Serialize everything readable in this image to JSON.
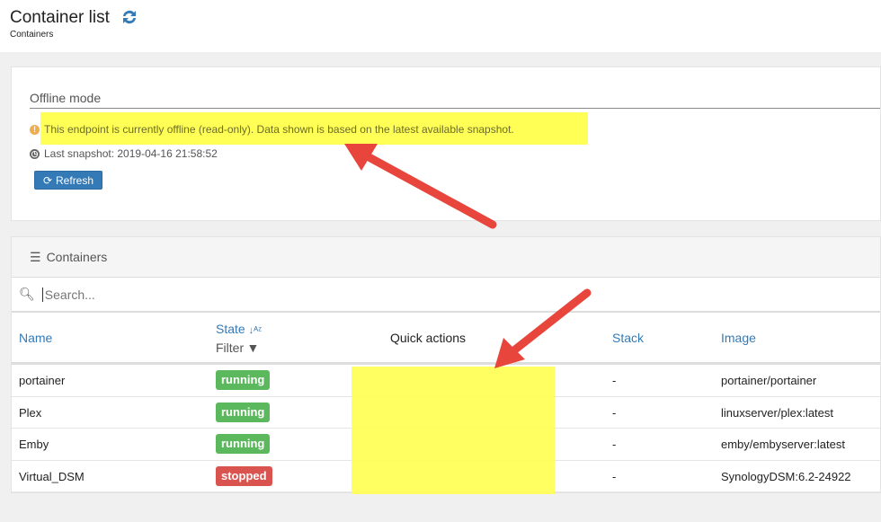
{
  "header": {
    "title": "Container list",
    "subtitle": "Containers"
  },
  "offline": {
    "title": "Offline mode",
    "message": "This endpoint is currently offline (read-only). Data shown is based on the latest available snapshot.",
    "snapshot": "Last snapshot: 2019-04-16 21:58:52",
    "refresh_label": "Refresh"
  },
  "containers": {
    "title": "Containers",
    "search_placeholder": "Search...",
    "columns": {
      "name": "Name",
      "state": "State",
      "state_filter": "Filter",
      "quick_actions": "Quick actions",
      "stack": "Stack",
      "image": "Image"
    },
    "rows": [
      {
        "name": "portainer",
        "state": "running",
        "stack": "-",
        "image": "portainer/portainer"
      },
      {
        "name": "Plex",
        "state": "running",
        "stack": "-",
        "image": "linuxserver/plex:latest"
      },
      {
        "name": "Emby",
        "state": "running",
        "stack": "-",
        "image": "emby/embyserver:latest"
      },
      {
        "name": "Virtual_DSM",
        "state": "stopped",
        "stack": "-",
        "image": "SynologyDSM:6.2-24922"
      }
    ]
  },
  "colors": {
    "running": "#5cb85c",
    "stopped": "#d9534f",
    "highlight": "#ffff55",
    "arrow": "#e8453c",
    "link": "#337ab7"
  }
}
